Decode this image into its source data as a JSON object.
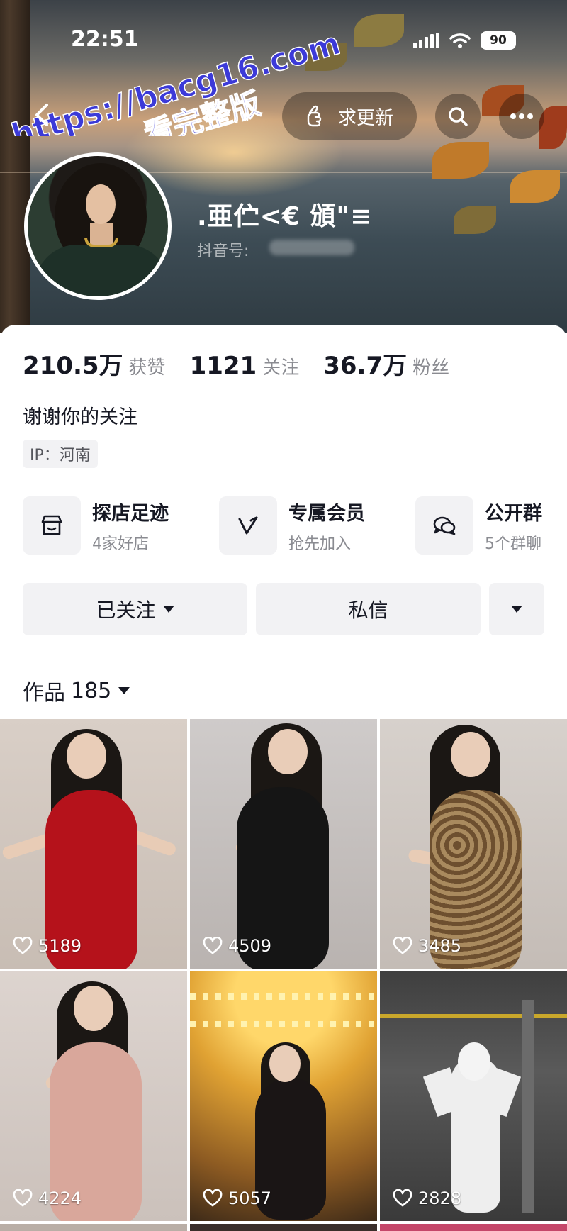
{
  "status_bar": {
    "time": "22:51",
    "battery": "90"
  },
  "watermark": {
    "line1": "https://bacg16.com",
    "line2": "看完整版"
  },
  "header": {
    "update_label": "求更新"
  },
  "profile": {
    "nickname": ".亜伫<€ 頒\"≡",
    "douyin_id_label": "抖音号:",
    "stats": [
      {
        "value": "210.5万",
        "label": "获赞"
      },
      {
        "value": "1121",
        "label": "关注"
      },
      {
        "value": "36.7万",
        "label": "粉丝"
      }
    ],
    "bio": "谢谢你的关注",
    "ip": "IP：河南"
  },
  "features": [
    {
      "title": "探店足迹",
      "subtitle": "4家好店",
      "icon": "shop-icon"
    },
    {
      "title": "专属会员",
      "subtitle": "抢先加入",
      "icon": "vip-icon"
    },
    {
      "title": "公开群",
      "subtitle": "5个群聊",
      "icon": "group-chat-icon"
    }
  ],
  "actions": {
    "follow_label": "已关注",
    "message_label": "私信"
  },
  "works": {
    "label": "作品",
    "count": "185",
    "items": [
      {
        "likes": "5189",
        "color": "#b5121b"
      },
      {
        "likes": "4509",
        "color": "#151515"
      },
      {
        "likes": "3485",
        "color": "#8a6a45"
      },
      {
        "likes": "4224",
        "color": "#d9a79b"
      },
      {
        "likes": "5057",
        "color": "#1a1515"
      },
      {
        "likes": "2828",
        "color": "#eeeeee"
      }
    ]
  },
  "colors": {
    "accent_text": "#161823",
    "muted_text": "#8a8b91",
    "button_bg": "#f2f2f4"
  }
}
